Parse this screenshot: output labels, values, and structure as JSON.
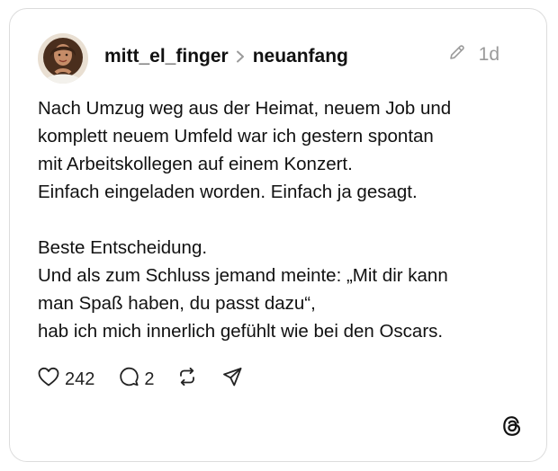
{
  "post": {
    "author": "mitt_el_finger",
    "topic": "neuanfang",
    "age": "1d",
    "text": "Nach Umzug weg aus der Heimat, neuem Job und\nkomplett neuem Umfeld war ich gestern spontan\nmit Arbeitskollegen auf einem Konzert.\nEinfach eingeladen worden. Einfach ja gesagt.\n\nBeste Entscheidung.\nUnd als zum Schluss jemand meinte: „Mit dir kann\nman Spaß haben, du passt dazu“,\nhab ich mich innerlich gefühlt wie bei den Oscars.",
    "likes": "242",
    "replies": "2"
  },
  "icons": {
    "separator": "chevron-right-icon",
    "edit": "pencil-icon",
    "like": "heart-icon",
    "reply": "speech-bubble-icon",
    "repost": "repost-icon",
    "share": "send-icon",
    "brand": "threads-logo-icon"
  },
  "colors": {
    "text": "#111111",
    "muted": "#9a9a9a",
    "border": "#dcdcdc"
  }
}
